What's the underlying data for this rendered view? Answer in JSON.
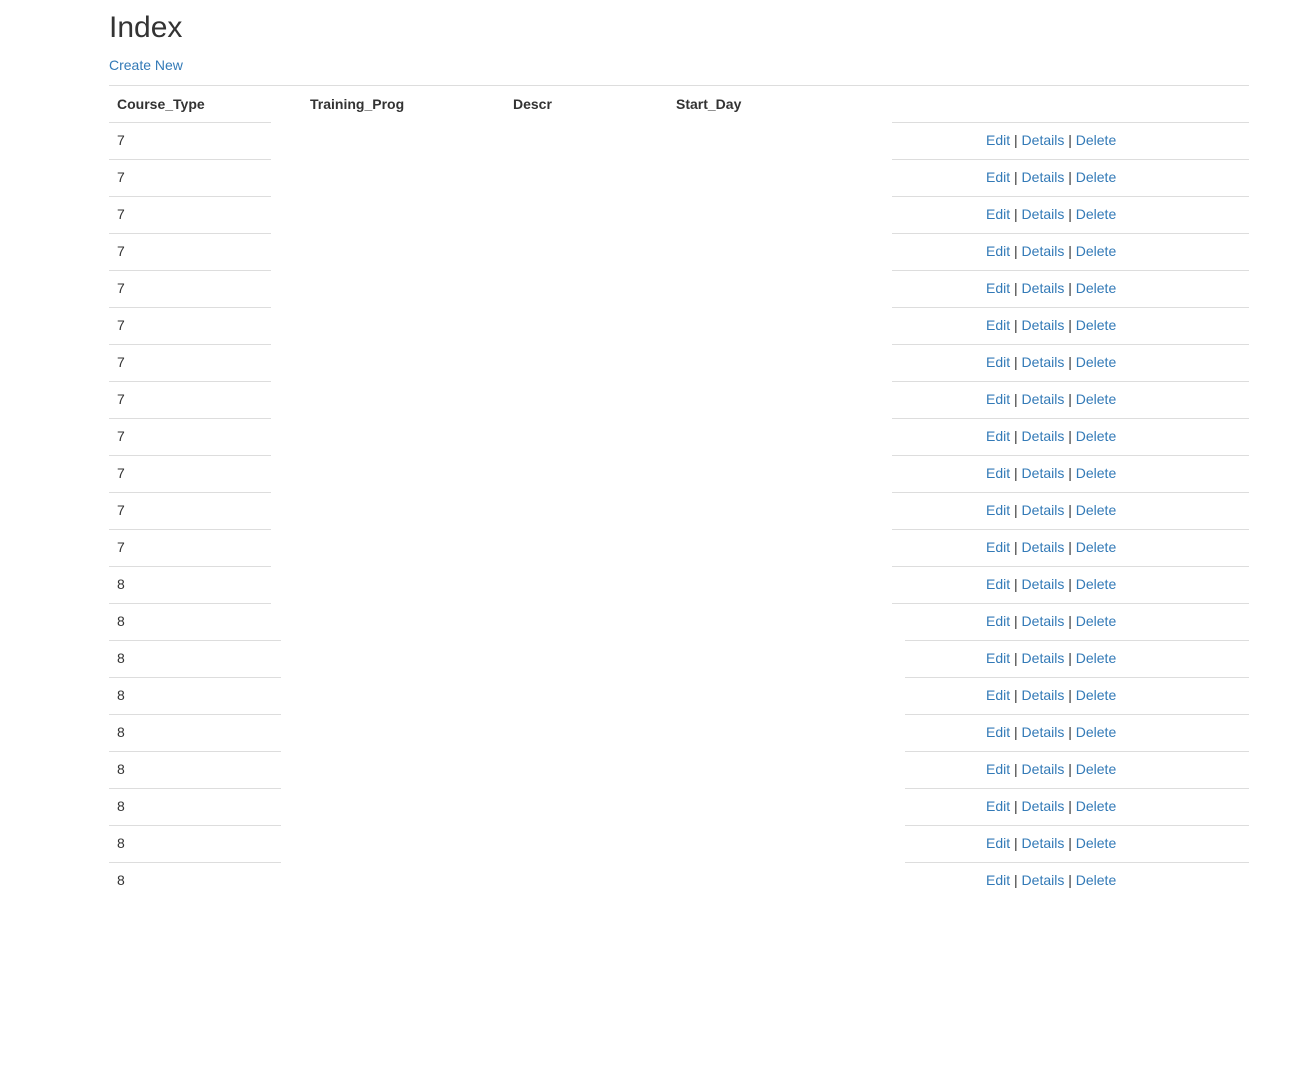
{
  "page": {
    "title": "Index",
    "create_new": "Create New"
  },
  "table": {
    "headers": [
      "Course_Type",
      "Training_Prog",
      "Descr",
      "Start_Day",
      ""
    ],
    "action_labels": {
      "edit": "Edit",
      "details": "Details",
      "delete": "Delete",
      "separator": "|"
    },
    "rows": [
      {
        "course_type": "7",
        "training_prog": "",
        "descr": "",
        "start_day": ""
      },
      {
        "course_type": "7",
        "training_prog": "",
        "descr": "",
        "start_day": ""
      },
      {
        "course_type": "7",
        "training_prog": "",
        "descr": "",
        "start_day": ""
      },
      {
        "course_type": "7",
        "training_prog": "",
        "descr": "",
        "start_day": ""
      },
      {
        "course_type": "7",
        "training_prog": "",
        "descr": "",
        "start_day": ""
      },
      {
        "course_type": "7",
        "training_prog": "",
        "descr": "",
        "start_day": ""
      },
      {
        "course_type": "7",
        "training_prog": "",
        "descr": "",
        "start_day": ""
      },
      {
        "course_type": "7",
        "training_prog": "",
        "descr": "",
        "start_day": ""
      },
      {
        "course_type": "7",
        "training_prog": "",
        "descr": "",
        "start_day": ""
      },
      {
        "course_type": "7",
        "training_prog": "",
        "descr": "",
        "start_day": ""
      },
      {
        "course_type": "7",
        "training_prog": "",
        "descr": "",
        "start_day": ""
      },
      {
        "course_type": "7",
        "training_prog": "",
        "descr": "",
        "start_day": ""
      },
      {
        "course_type": "8",
        "training_prog": "",
        "descr": "",
        "start_day": ""
      },
      {
        "course_type": "8",
        "training_prog": "",
        "descr": "",
        "start_day": ""
      },
      {
        "course_type": "8",
        "training_prog": "",
        "descr": "",
        "start_day": ""
      },
      {
        "course_type": "8",
        "training_prog": "",
        "descr": "",
        "start_day": ""
      },
      {
        "course_type": "8",
        "training_prog": "",
        "descr": "",
        "start_day": ""
      },
      {
        "course_type": "8",
        "training_prog": "",
        "descr": "",
        "start_day": ""
      },
      {
        "course_type": "8",
        "training_prog": "",
        "descr": "",
        "start_day": ""
      },
      {
        "course_type": "8",
        "training_prog": "",
        "descr": "",
        "start_day": ""
      },
      {
        "course_type": "8",
        "training_prog": "",
        "descr": "",
        "start_day": ""
      }
    ]
  },
  "colors": {
    "link": "#337ab7",
    "text": "#333333",
    "border": "#dddddd"
  }
}
